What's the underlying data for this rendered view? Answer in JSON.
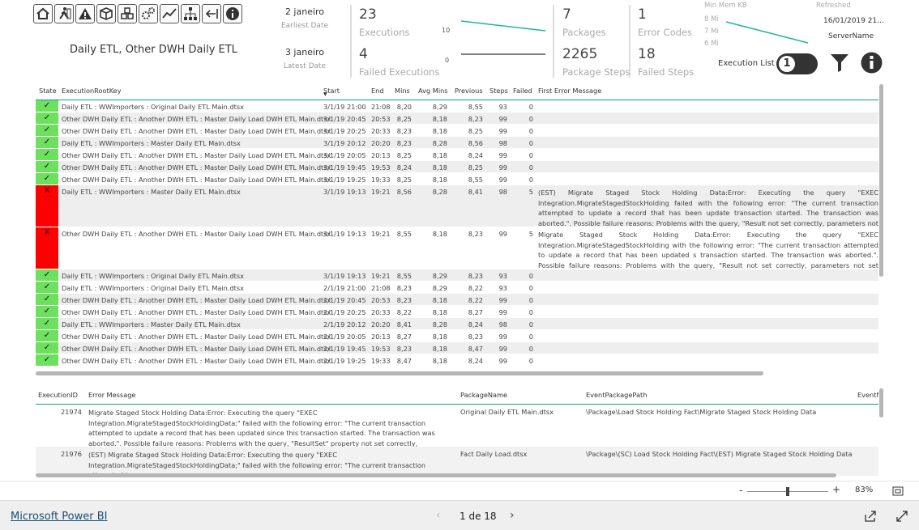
{
  "header": {
    "title": "Daily ETL, Other DWH Daily ETL",
    "earliest_value": "2 janeiro",
    "earliest_label": "Earliest Date",
    "latest_value": "3 janeiro",
    "latest_label": "Latest Date",
    "executions_value": "23",
    "executions_label": "Executions",
    "failed_exec_value": "4",
    "failed_exec_label": "Failed Executions",
    "exec_ticks": [
      "10",
      "0"
    ],
    "packages_value": "7",
    "packages_label": "Packages",
    "pkgsteps_value": "2265",
    "pkgsteps_label": "Package Steps",
    "errcodes_value": "1",
    "errcodes_label": "Error Codes",
    "failedsteps_value": "18",
    "failedsteps_label": "Failed Steps",
    "minmem_label": "Min Mem KB",
    "mem_ticks": [
      "8 Mi",
      "7 Mi",
      "6 Mi"
    ],
    "refreshed_label": "Refreshed",
    "refreshed_value": "16/01/2019 21...",
    "servername_label": "ServerName",
    "execlist_label": "Execution List",
    "execlist_toggle": "1",
    "icons": [
      "home-icon",
      "exit-icon",
      "warning-icon",
      "package-icon",
      "packages-icon",
      "gears-icon",
      "trend-icon",
      "hierarchy-icon",
      "back-icon",
      "info-icon"
    ],
    "accent": "#1fb5a6"
  },
  "table1": {
    "columns": [
      "State",
      "ExecutionRootKey",
      "Start",
      "End",
      "Mins",
      "Avg Mins",
      "Previous",
      "Steps",
      "Failed",
      "First Error Message"
    ],
    "rows": [
      {
        "state": "✓",
        "key": "Daily ETL : WWImporters : Original Daily ETL Main.dtsx",
        "start": "3/1/19 21:00",
        "end": "21:08",
        "mins": "8,20",
        "avg": "8,29",
        "prev": "8,55",
        "steps": "93",
        "failed": "0",
        "msg": ""
      },
      {
        "state": "✓",
        "key": "Other DWH Daily ETL : Another DWH ETL : Master Daily Load DWH ETL Main.dtsx",
        "start": "3/1/19 20:45",
        "end": "20:53",
        "mins": "8,25",
        "avg": "8,18",
        "prev": "8,23",
        "steps": "99",
        "failed": "0",
        "msg": ""
      },
      {
        "state": "✓",
        "key": "Other DWH Daily ETL : Another DWH ETL : Master Daily Load DWH ETL Main.dtsx",
        "start": "3/1/19 20:25",
        "end": "20:33",
        "mins": "8,23",
        "avg": "8,18",
        "prev": "8,25",
        "steps": "99",
        "failed": "0",
        "msg": ""
      },
      {
        "state": "✓",
        "key": "Daily ETL : WWImporters : Master Daily ETL Main.dtsx",
        "start": "3/1/19 20:12",
        "end": "20:20",
        "mins": "8,23",
        "avg": "8,28",
        "prev": "8,56",
        "steps": "98",
        "failed": "0",
        "msg": ""
      },
      {
        "state": "✓",
        "key": "Other DWH Daily ETL : Another DWH ETL : Master Daily Load DWH ETL Main.dtsx",
        "start": "3/1/19 20:05",
        "end": "20:13",
        "mins": "8,25",
        "avg": "8,18",
        "prev": "8,24",
        "steps": "99",
        "failed": "0",
        "msg": ""
      },
      {
        "state": "✓",
        "key": "Other DWH Daily ETL : Another DWH ETL : Master Daily Load DWH ETL Main.dtsx",
        "start": "3/1/19 19:45",
        "end": "19:53",
        "mins": "8,24",
        "avg": "8,18",
        "prev": "8,25",
        "steps": "99",
        "failed": "0",
        "msg": ""
      },
      {
        "state": "✓",
        "key": "Other DWH Daily ETL : Another DWH ETL : Master Daily Load DWH ETL Main.dtsx",
        "start": "3/1/19 19:25",
        "end": "19:33",
        "mins": "8,25",
        "avg": "8,18",
        "prev": "8,55",
        "steps": "99",
        "failed": "0",
        "msg": ""
      },
      {
        "state": "X",
        "key": "Daily ETL : WWImporters : Master Daily ETL Main.dtsx",
        "start": "3/1/19 19:13",
        "end": "19:21",
        "mins": "8,56",
        "avg": "8,28",
        "prev": "8,41",
        "steps": "98",
        "failed": "5",
        "msg": "(EST) Migrate Staged Stock Holding Data:Error: Executing the query \"EXEC Integration.MigrateStagedStockHolding failed with the following error: \"The current transaction attempted to update a record that has been update transaction started. The transaction was aborted.\". Possible failure reasons: Problems with the query, \"Result not set correctly, parameters not set correctly, or connection not established correctly."
      },
      {
        "state": "X",
        "key": "Other DWH Daily ETL : Another DWH ETL : Master Daily Load DWH ETL Main.dtsx",
        "start": "3/1/19 19:13",
        "end": "19:21",
        "mins": "8,55",
        "avg": "8,18",
        "prev": "8,23",
        "steps": "99",
        "failed": "5",
        "msg": "Migrate Staged Stock Holding Data:Error: Executing the query \"EXEC Integration.MigrateStagedStockHolding with the following error: \"The current transaction attempted to update a record that has been updated s transaction started. The transaction was aborted.\". Possible failure reasons: Problems with the query, \"Result not set correctly, parameters not set correctly, or connection not established correctly."
      },
      {
        "state": "✓",
        "key": "Daily ETL : WWImporters : Original Daily ETL Main.dtsx",
        "start": "3/1/19 19:13",
        "end": "19:21",
        "mins": "8,55",
        "avg": "8,29",
        "prev": "8,23",
        "steps": "93",
        "failed": "0",
        "msg": ""
      },
      {
        "state": "✓",
        "key": "Daily ETL : WWImporters : Original Daily ETL Main.dtsx",
        "start": "2/1/19 21:00",
        "end": "21:08",
        "mins": "8,23",
        "avg": "8,29",
        "prev": "8,22",
        "steps": "93",
        "failed": "0",
        "msg": ""
      },
      {
        "state": "✓",
        "key": "Other DWH Daily ETL : Another DWH ETL : Master Daily Load DWH ETL Main.dtsx",
        "start": "2/1/19 20:45",
        "end": "20:53",
        "mins": "8,23",
        "avg": "8,18",
        "prev": "8,22",
        "steps": "99",
        "failed": "0",
        "msg": ""
      },
      {
        "state": "✓",
        "key": "Other DWH Daily ETL : Another DWH ETL : Master Daily Load DWH ETL Main.dtsx",
        "start": "2/1/19 20:25",
        "end": "20:33",
        "mins": "8,22",
        "avg": "8,18",
        "prev": "8,27",
        "steps": "99",
        "failed": "0",
        "msg": ""
      },
      {
        "state": "✓",
        "key": "Daily ETL : WWImporters : Master Daily ETL Main.dtsx",
        "start": "2/1/19 20:12",
        "end": "20:20",
        "mins": "8,41",
        "avg": "8,28",
        "prev": "8,24",
        "steps": "98",
        "failed": "0",
        "msg": ""
      },
      {
        "state": "✓",
        "key": "Other DWH Daily ETL : Another DWH ETL : Master Daily Load DWH ETL Main.dtsx",
        "start": "2/1/19 20:05",
        "end": "20:13",
        "mins": "8,27",
        "avg": "8,18",
        "prev": "8,23",
        "steps": "99",
        "failed": "0",
        "msg": ""
      },
      {
        "state": "✓",
        "key": "Other DWH Daily ETL : Another DWH ETL : Master Daily Load DWH ETL Main.dtsx",
        "start": "2/1/19 19:45",
        "end": "19:53",
        "mins": "8,23",
        "avg": "8,18",
        "prev": "8,47",
        "steps": "99",
        "failed": "0",
        "msg": ""
      },
      {
        "state": "✓",
        "key": "Other DWH Daily ETL : Another DWH ETL : Master Daily Load DWH ETL Main.dtsx",
        "start": "2/1/19 19:25",
        "end": "19:33",
        "mins": "8,47",
        "avg": "8,18",
        "prev": "8,24",
        "steps": "99",
        "failed": "0",
        "msg": ""
      }
    ]
  },
  "table2": {
    "columns": [
      "ExecutionID",
      "Error Message",
      "PackageName",
      "EventPackagePath",
      "EventN"
    ],
    "rows": [
      {
        "id": "21974",
        "msg": "Migrate Staged Stock Holding Data:Error: Executing the query \"EXEC Integration.MigrateStagedStockHoldingData;\" failed with the following error: \"The current transaction attempted to update a record that has been updated since this transaction started. The transaction was aborted.\". Possible failure reasons: Problems with the query, \"ResultSet\" property not set correctly, parameters not set correctly, or connection not established correctly.",
        "pkg": "Original Daily ETL Main.dtsx",
        "path": "\\Package\\Load Stock Holding Fact\\Migrate Staged Stock Holding Data"
      },
      {
        "id": "21976",
        "msg": "(EST) Migrate Staged Stock Holding Data:Error: Executing the query \"EXEC Integration.MigrateStagedStockHoldingData;\" failed with the following error: \"The current transaction attempted to",
        "pkg": "Fact Daily Load.dtsx",
        "path": "\\Package\\(SC) Load Stock Holding Fact\\(EST) Migrate Staged Stock Holding Data"
      }
    ]
  },
  "zoom": {
    "minus": "-",
    "plus": "+",
    "value": "83%",
    "level": 0.5
  },
  "footer": {
    "brand": "Microsoft Power BI",
    "page": "1 de 18"
  }
}
